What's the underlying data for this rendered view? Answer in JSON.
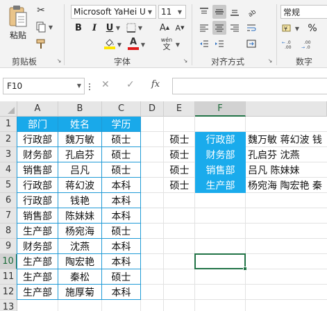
{
  "ribbon": {
    "clipboard": {
      "paste_label": "粘贴",
      "group_label": "剪贴板"
    },
    "font": {
      "font_name": "Microsoft YaHei UI",
      "font_size": "11",
      "bold": "B",
      "italic": "I",
      "underline": "U",
      "phonetic": "wén",
      "group_label": "字体",
      "font_color": "#e01b1b",
      "fill_color": "#ffe600"
    },
    "alignment": {
      "group_label": "对齐方式"
    },
    "number": {
      "format": "常规",
      "percent": "%",
      "group_label": "数字"
    }
  },
  "formula_bar": {
    "name_box": "F10",
    "fx": "fx",
    "formula": ""
  },
  "columns": [
    "A",
    "B",
    "C",
    "D",
    "E",
    "F"
  ],
  "rows": [
    "1",
    "2",
    "3",
    "4",
    "5",
    "6",
    "7",
    "8",
    "9",
    "10",
    "11",
    "12",
    "13"
  ],
  "active_cell": {
    "column": "F",
    "row": "10"
  },
  "table": {
    "headers": [
      "部门",
      "姓名",
      "学历"
    ],
    "rows": [
      [
        "行政部",
        "魏万敏",
        "硕士"
      ],
      [
        "财务部",
        "孔启芬",
        "硕士"
      ],
      [
        "销售部",
        "吕凡",
        "硕士"
      ],
      [
        "行政部",
        "蒋幻波",
        "本科"
      ],
      [
        "行政部",
        "钱艳",
        "本科"
      ],
      [
        "销售部",
        "陈妹妹",
        "本科"
      ],
      [
        "生产部",
        "杨宛海",
        "硕士"
      ],
      [
        "财务部",
        "沈燕",
        "本科"
      ],
      [
        "生产部",
        "陶宏艳",
        "本科"
      ],
      [
        "生产部",
        "秦松",
        "硕士"
      ],
      [
        "生产部",
        "施厚菊",
        "本科"
      ]
    ]
  },
  "result": {
    "rows": [
      {
        "edu": "硕士",
        "dept": "行政部",
        "names": "魏万敏 蒋幻波 钱"
      },
      {
        "edu": "硕士",
        "dept": "财务部",
        "names": "孔启芬 沈燕"
      },
      {
        "edu": "硕士",
        "dept": "销售部",
        "names": "吕凡 陈妹妹"
      },
      {
        "edu": "硕士",
        "dept": "生产部",
        "names": "杨宛海 陶宏艳 秦"
      }
    ]
  },
  "colors": {
    "accent_green": "#217346",
    "table_header_blue": "#19a9ea",
    "table_border_blue": "#1f9ad6"
  }
}
